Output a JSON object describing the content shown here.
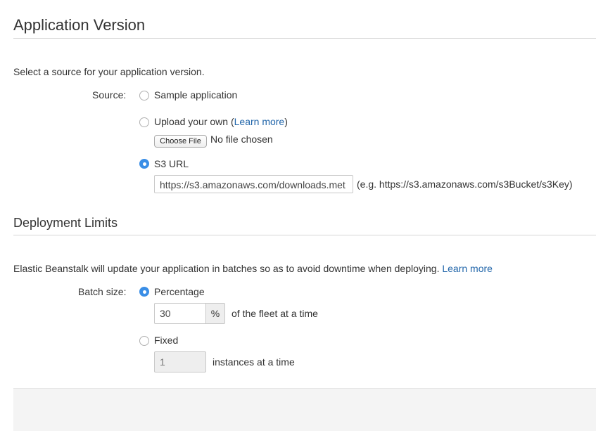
{
  "app_version": {
    "title": "Application Version",
    "intro": "Select a source for your application version.",
    "source_label": "Source:",
    "options": {
      "sample": {
        "label": "Sample application",
        "checked": false
      },
      "upload": {
        "label_prefix": "Upload your own (",
        "learn_more": "Learn more",
        "label_suffix": ")",
        "checked": false
      },
      "s3": {
        "label": "S3 URL",
        "checked": true
      }
    },
    "file": {
      "button": "Choose File",
      "status": "No file chosen"
    },
    "s3_url": {
      "value": "https://s3.amazonaws.com/downloads.met",
      "hint": "(e.g. https://s3.amazonaws.com/s3Bucket/s3Key)"
    }
  },
  "deployment": {
    "title": "Deployment Limits",
    "intro": "Elastic Beanstalk will update your application in batches so as to avoid downtime when deploying.",
    "learn_more": "Learn more",
    "batch_label": "Batch size:",
    "percentage": {
      "label": "Percentage",
      "checked": true,
      "value": "30",
      "unit": "%",
      "suffix": "of the fleet at a time"
    },
    "fixed": {
      "label": "Fixed",
      "checked": false,
      "value": "1",
      "suffix": "instances at a time"
    }
  },
  "colors": {
    "accent": "#3a8ee6",
    "link": "#2266aa"
  },
  "icons": {
    "radio_selected": "radio-selected-icon",
    "radio_unselected": "radio-unselected-icon"
  }
}
